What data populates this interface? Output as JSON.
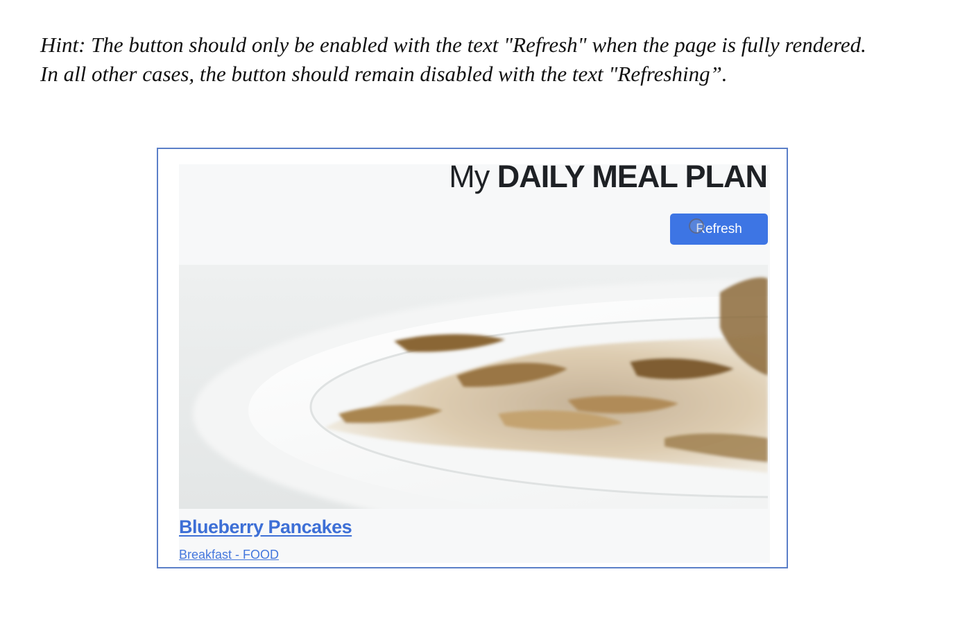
{
  "hint": {
    "line1": "Hint: The button should only be enabled with the text \"Refresh\" when the page is fully rendered.",
    "line2": "In all other cases, the button should remain disabled with the text \"Refreshing”."
  },
  "app": {
    "title_prefix": "My",
    "title_main": "DAILY MEAL PLAN",
    "refresh_label": "Refresh",
    "accent_color": "#3d75e4"
  },
  "meal": {
    "name": "Blueberry Pancakes",
    "meta": "Breakfast - FOOD"
  }
}
